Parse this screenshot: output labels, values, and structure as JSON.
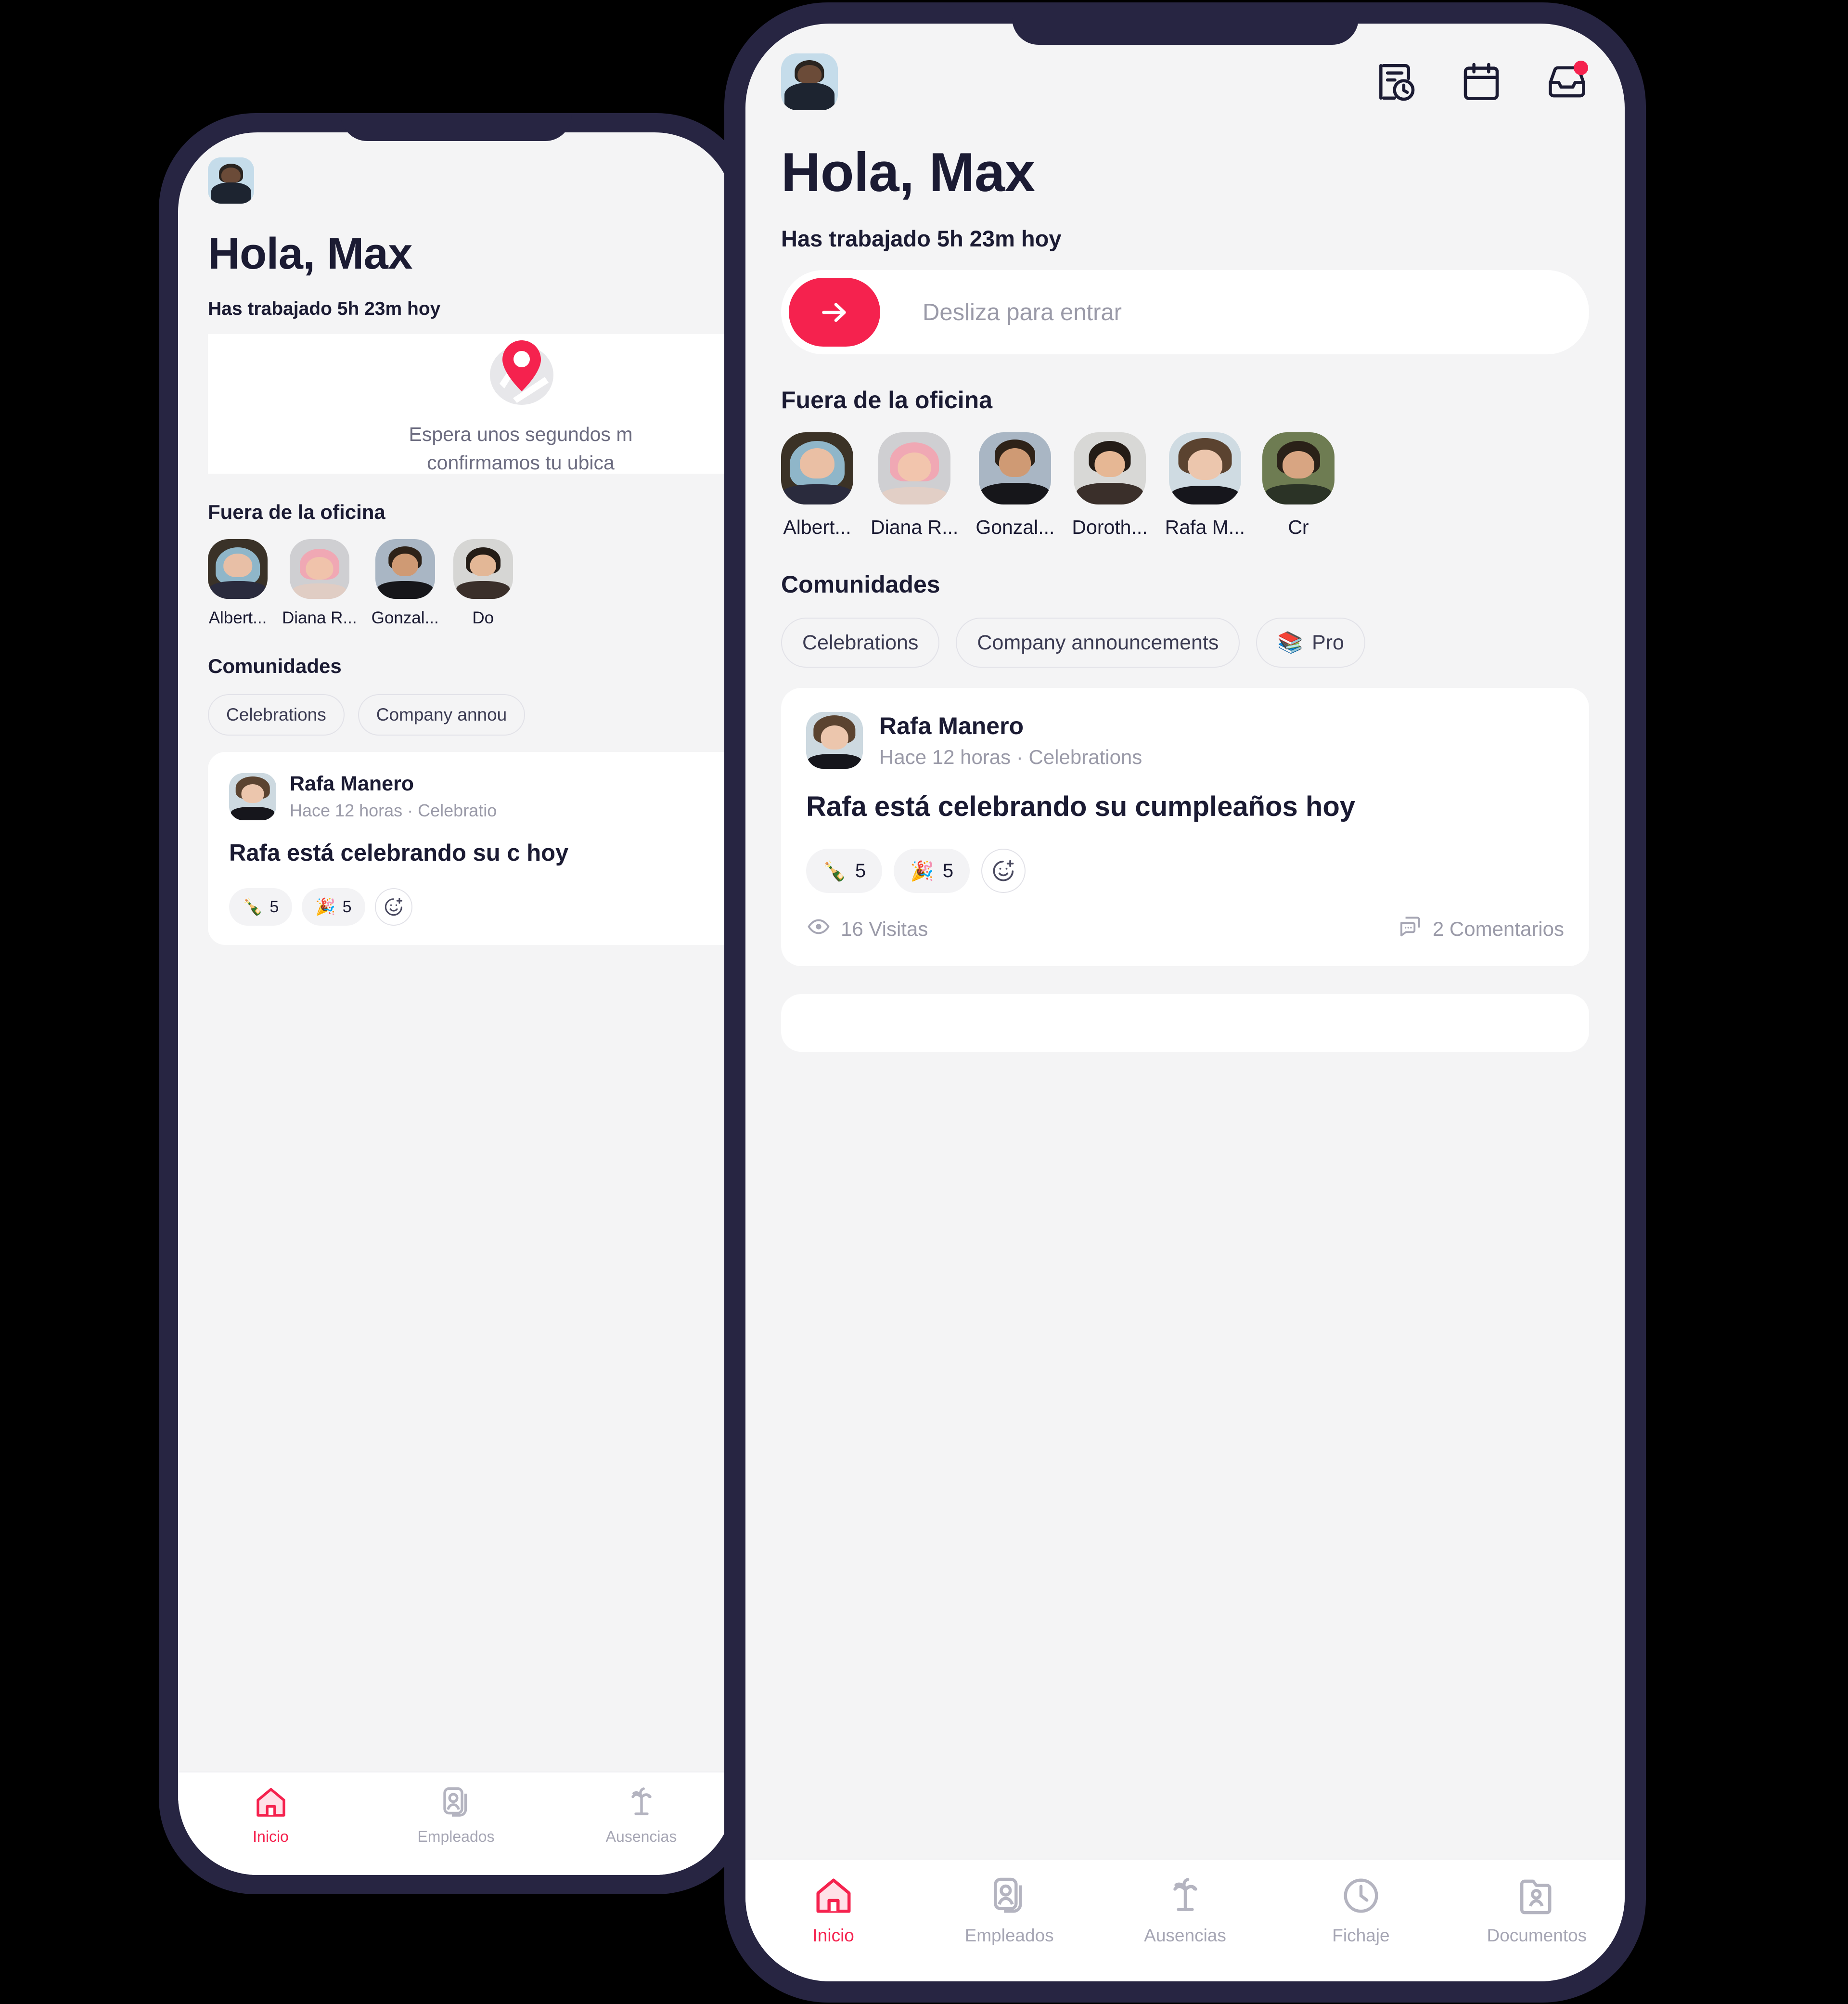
{
  "brand": {
    "accent": "#f5224e",
    "frame": "#272542",
    "screen_bg": "#f4f4f5",
    "text": "#1b1b33",
    "muted": "#9a9aa8"
  },
  "front_phone": {
    "header": {
      "avatar_name": "user-avatar",
      "icons": [
        {
          "name": "time-tracking-icon",
          "label": "Fichajes"
        },
        {
          "name": "calendar-icon",
          "label": "Calendario"
        },
        {
          "name": "inbox-icon",
          "label": "Bandeja",
          "badge": true
        }
      ]
    },
    "greeting": "Hola, Max",
    "worked_today": "Has trabajado 5h 23m hoy",
    "slider": {
      "label": "Desliza para entrar",
      "arrow_icon": "arrow-right-icon"
    },
    "out_of_office": {
      "title": "Fuera de la oficina",
      "people": [
        {
          "name": "Albert..."
        },
        {
          "name": "Diana R..."
        },
        {
          "name": "Gonzal..."
        },
        {
          "name": "Doroth..."
        },
        {
          "name": "Rafa M..."
        },
        {
          "name": "Cr"
        }
      ]
    },
    "communities": {
      "title": "Comunidades",
      "chips": [
        {
          "label": "Celebrations",
          "emoji": ""
        },
        {
          "label": "Company announcements",
          "emoji": ""
        },
        {
          "label": "Pro",
          "emoji": "📚"
        }
      ]
    },
    "post": {
      "author": "Rafa Manero",
      "meta": "Hace 12 horas  ·  Celebrations",
      "body": "Rafa está celebrando su cumpleaños hoy",
      "reactions": [
        {
          "emoji": "🍾",
          "count": "5"
        },
        {
          "emoji": "🎉",
          "count": "5"
        }
      ],
      "add_reaction_icon": "add-reaction-icon",
      "views": "16 Visitas",
      "views_icon": "eye-icon",
      "comments": "2 Comentarios",
      "comments_icon": "comment-icon"
    },
    "tabs": [
      {
        "label": "Inicio",
        "icon": "home-icon",
        "active": true
      },
      {
        "label": "Empleados",
        "icon": "employees-icon",
        "active": false
      },
      {
        "label": "Ausencias",
        "icon": "palm-tree-icon",
        "active": false
      },
      {
        "label": "Fichaje",
        "icon": "clock-icon",
        "active": false
      },
      {
        "label": "Documentos",
        "icon": "documents-icon",
        "active": false
      }
    ]
  },
  "back_phone": {
    "greeting": "Hola, Max",
    "worked_today": "Has trabajado 5h 23m hoy",
    "location_card": {
      "icon": "map-pin-icon",
      "line1": "Espera unos segundos m",
      "line2": "confirmamos tu ubica"
    },
    "out_of_office": {
      "title": "Fuera de la oficina",
      "people": [
        {
          "name": "Albert..."
        },
        {
          "name": "Diana R..."
        },
        {
          "name": "Gonzal..."
        },
        {
          "name": "Do"
        }
      ]
    },
    "communities": {
      "title": "Comunidades",
      "chips": [
        {
          "label": "Celebrations"
        },
        {
          "label": "Company annou"
        }
      ]
    },
    "post": {
      "author": "Rafa Manero",
      "meta": "Hace 12 horas  ·  Celebratio",
      "body": "Rafa está celebrando su c hoy",
      "reactions": [
        {
          "emoji": "🍾",
          "count": "5"
        },
        {
          "emoji": "🎉",
          "count": "5"
        }
      ]
    },
    "tabs": [
      {
        "label": "Inicio",
        "icon": "home-icon",
        "active": true
      },
      {
        "label": "Empleados",
        "icon": "employees-icon",
        "active": false
      },
      {
        "label": "Ausencias",
        "icon": "palm-tree-icon",
        "active": false
      }
    ]
  }
}
